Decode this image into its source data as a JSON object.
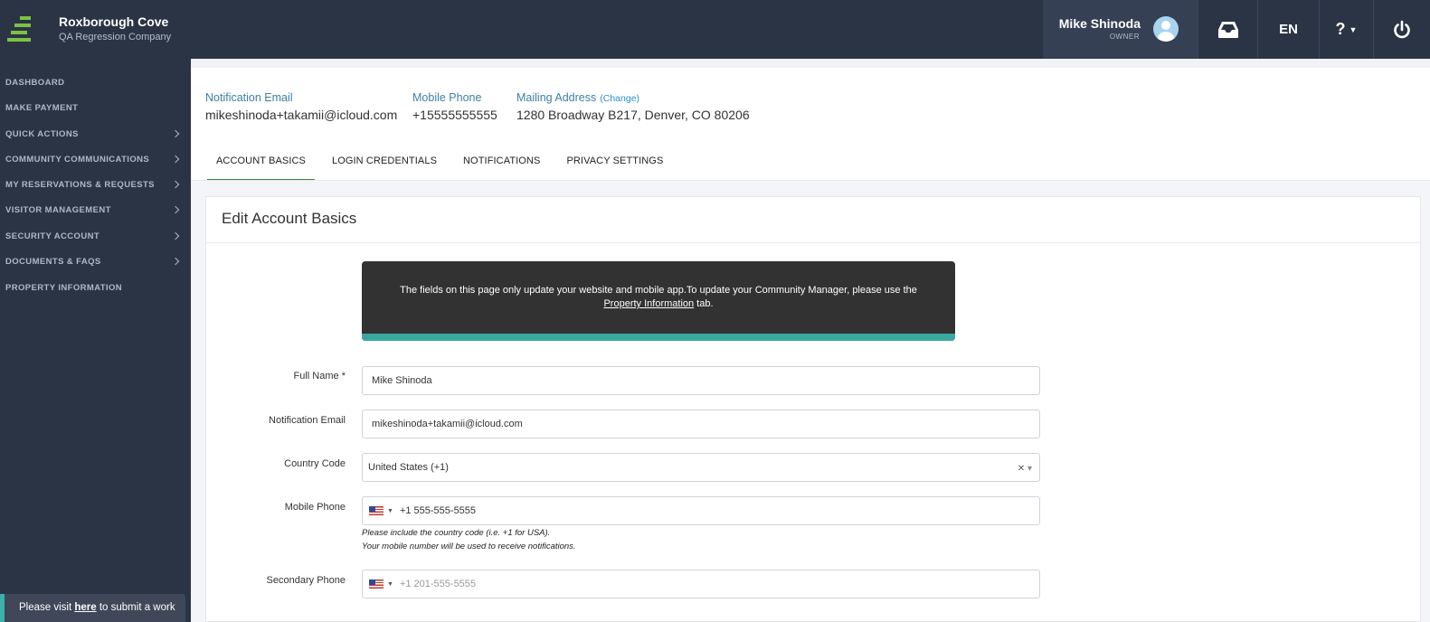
{
  "header": {
    "org_name": "Roxborough Cove",
    "org_subtitle": "QA Regression Company",
    "user_name": "Mike Shinoda",
    "user_role": "OWNER",
    "language": "EN",
    "help_label": "?"
  },
  "sidebar": {
    "items": [
      {
        "label": "DASHBOARD",
        "has_chevron": false
      },
      {
        "label": "MAKE PAYMENT",
        "has_chevron": false
      },
      {
        "label": "QUICK ACTIONS",
        "has_chevron": true
      },
      {
        "label": "COMMUNITY COMMUNICATIONS",
        "has_chevron": true
      },
      {
        "label": "MY RESERVATIONS & REQUESTS",
        "has_chevron": true
      },
      {
        "label": "VISITOR MANAGEMENT",
        "has_chevron": true
      },
      {
        "label": "SECURITY ACCOUNT",
        "has_chevron": true
      },
      {
        "label": "DOCUMENTS & FAQS",
        "has_chevron": true
      },
      {
        "label": "PROPERTY INFORMATION",
        "has_chevron": false
      }
    ],
    "toast": {
      "prefix": "Please visit ",
      "link": "here",
      "suffix": " to submit a work"
    }
  },
  "profile_summary": {
    "notification_email_label": "Notification Email",
    "notification_email": "mikeshinoda+takamii@icloud.com",
    "mobile_phone_label": "Mobile Phone",
    "mobile_phone": "+15555555555",
    "mailing_address_label": "Mailing Address",
    "mailing_address_change": "(Change)",
    "mailing_address": "1280 Broadway B217, Denver, CO 80206"
  },
  "tabs": [
    {
      "label": "ACCOUNT BASICS",
      "active": true
    },
    {
      "label": "LOGIN CREDENTIALS",
      "active": false
    },
    {
      "label": "NOTIFICATIONS",
      "active": false
    },
    {
      "label": "PRIVACY SETTINGS",
      "active": false
    }
  ],
  "panel": {
    "title": "Edit Account Basics",
    "notice": {
      "text": "The fields on this page only update your website and mobile app.To update your Community Manager, please use the ",
      "link": "Property Information",
      "suffix": " tab."
    },
    "fields": {
      "full_name_label": "Full Name *",
      "full_name_value": "Mike Shinoda",
      "notification_email_label": "Notification Email",
      "notification_email_value": "mikeshinoda+takamii@icloud.com",
      "country_code_label": "Country Code",
      "country_code_value": "United States (+1)",
      "mobile_phone_label": "Mobile Phone",
      "mobile_phone_value": "+1 555-555-5555",
      "mobile_help_1": "Please include the country code (i.e. +1 for USA).",
      "mobile_help_2": "Your mobile number will be used to receive notifications.",
      "secondary_phone_label": "Secondary Phone",
      "secondary_phone_placeholder": "+1 201-555-5555"
    }
  },
  "colors": {
    "topbar": "#2b3445",
    "accent_green": "#7cc242",
    "active_tab": "#3c8b3c",
    "notice_strip": "#3aa7a0",
    "link_blue": "#3f7fa4"
  }
}
